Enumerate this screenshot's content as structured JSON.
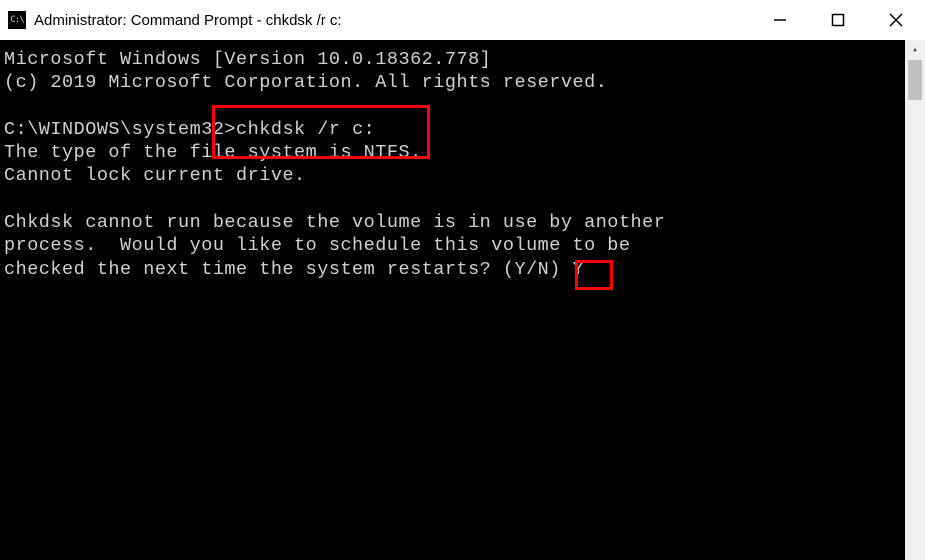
{
  "titlebar": {
    "icon_label": "C:\\",
    "title": "Administrator: Command Prompt - chkdsk /r c:"
  },
  "terminal": {
    "line1": "Microsoft Windows [Version 10.0.18362.778]",
    "line2": "(c) 2019 Microsoft Corporation. All rights reserved.",
    "blank1": "",
    "prompt_path": "C:\\WINDOWS\\system32>",
    "prompt_cmd": "chkdsk /r c:",
    "line4": "The type of the file system is NTFS.",
    "line5": "Cannot lock current drive.",
    "blank2": "",
    "line6": "Chkdsk cannot run because the volume is in use by another",
    "line7": "process.  Would you like to schedule this volume to be",
    "line8a": "checked the next time the system restarts? (Y/N) ",
    "line8_input": "Y"
  }
}
